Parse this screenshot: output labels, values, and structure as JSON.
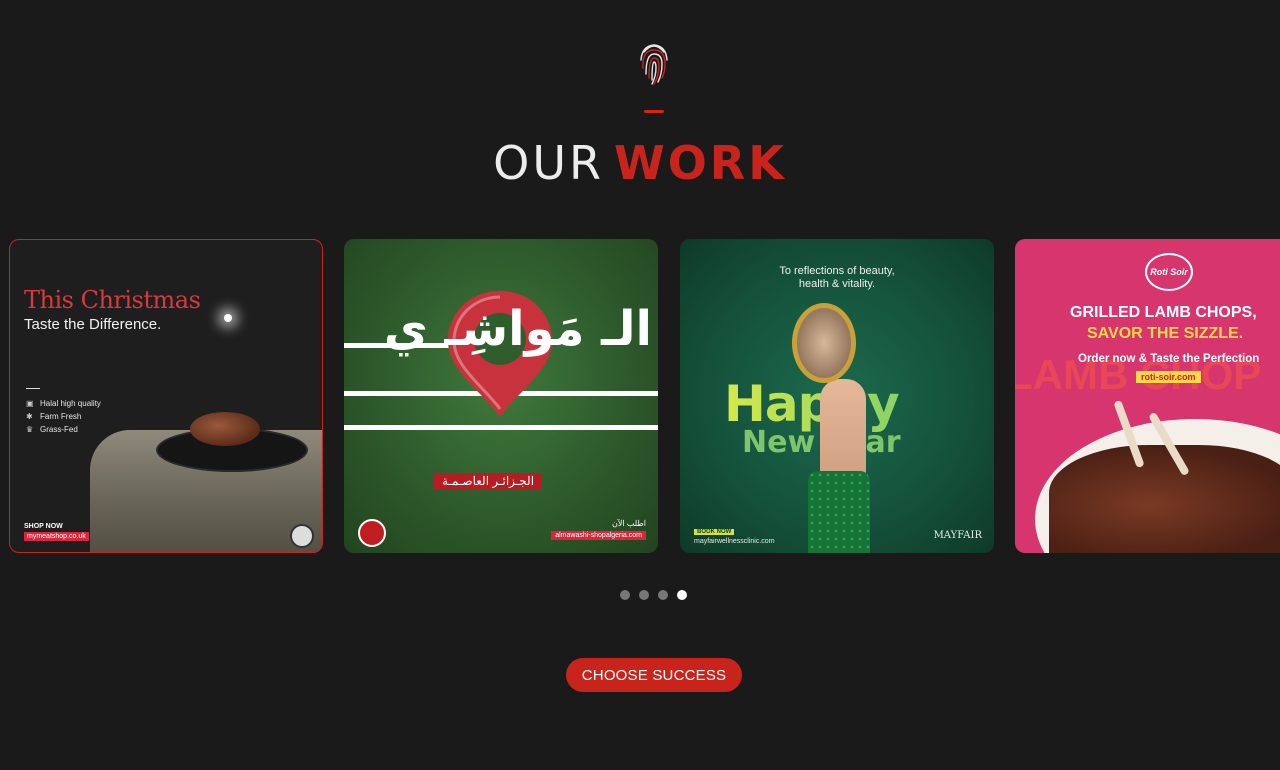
{
  "header": {
    "logo_icon": "fingerprint-icon",
    "title_light": "OUR",
    "title_bold": "WORK",
    "accent_color": "#c9241c"
  },
  "carousel": {
    "cards": [
      {
        "title": "This Christmas",
        "subtitle": "Taste the Difference.",
        "features": [
          "Halal high quality",
          "Farm Fresh",
          "Grass-Fed"
        ],
        "shop_label": "SHOP NOW",
        "url": "mymeatshop.co.uk"
      },
      {
        "arabic_title": "الـ مَواشِـ ي",
        "city": "الجـزائـر العاصـمـة",
        "order_text": "اطلب الآن",
        "url": "almawashi-shopalgeria.com"
      },
      {
        "tagline_line1": "To reflections of beauty,",
        "tagline_line2": "health & vitality.",
        "happy": "Happy",
        "new_year": "New year",
        "book_label": "BOOK NOW",
        "url": "mayfairwellnessclinic.com",
        "brand": "MAYFAIR"
      },
      {
        "logo": "Roti Soir",
        "headline_line1": "GRILLED LAMB CHOPS,",
        "headline_line2": "SAVOR THE SIZZLE.",
        "background_word": "LAMB CHOP",
        "order_text": "Order now & Taste the Perfection",
        "url": "roti-soir.com"
      }
    ],
    "pagination": {
      "total": 4,
      "active": 4
    }
  },
  "cta": {
    "label": "CHOOSE SUCCESS"
  }
}
